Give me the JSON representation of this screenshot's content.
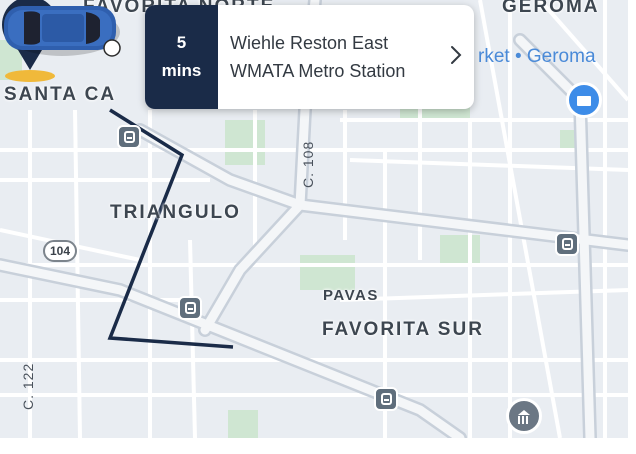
{
  "eta": {
    "value": "5",
    "unit": "mins"
  },
  "destination": {
    "line1": "Wiehle Reston East",
    "line2": "WMATA Metro Station"
  },
  "map": {
    "places": {
      "favorita_norte": "FAVORITA NORTE",
      "geroma": "GEROMA",
      "santa_cata": "SANTA CA",
      "triangulo": "TRIANGULO",
      "pavas": "PAVAS",
      "favorita_sur": "FAVORITA SUR"
    },
    "roads": {
      "c108": "C. 108",
      "c122": "C. 122",
      "route104": "104"
    },
    "poi_text": "rket • Geroma"
  },
  "icons": {
    "pickup": "person-pin-icon",
    "car": "car-icon",
    "bus": "bus-stop-icon",
    "shop": "shopping-icon",
    "gov": "government-building-icon",
    "chevron": "chevron-right-icon"
  },
  "colors": {
    "route": "#1a2b48",
    "eta_bg": "#1a2b48",
    "pin_gold": "#f0b93a",
    "car_blue": "#2f5fae",
    "map_bg": "#e9edf2",
    "park_green": "#cfe6d2"
  }
}
